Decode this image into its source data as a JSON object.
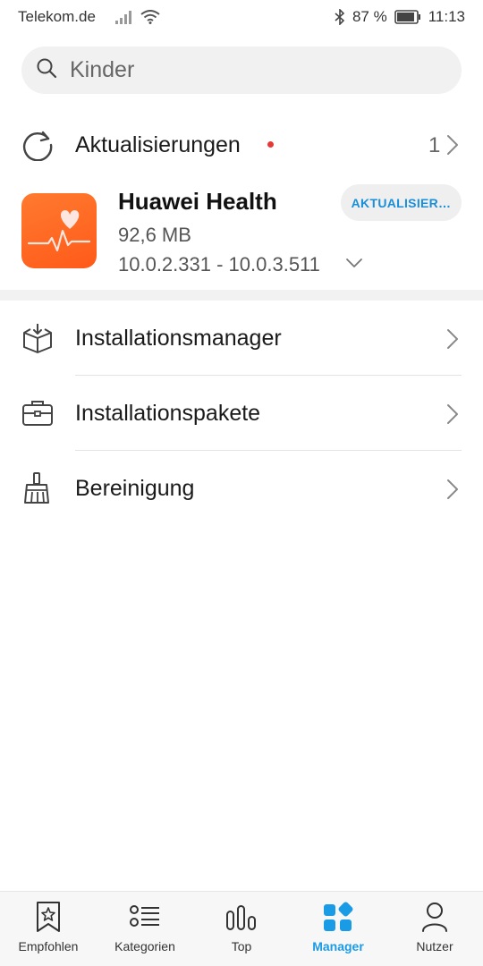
{
  "status_bar": {
    "carrier": "Telekom.de",
    "battery_percent": "87 %",
    "time": "11:13"
  },
  "search": {
    "placeholder": "Kinder"
  },
  "updates": {
    "title": "Aktualisierungen",
    "count": "1",
    "has_new_indicator": true
  },
  "app_update": {
    "name": "Huawei Health",
    "size": "92,6 MB",
    "version": "10.0.2.331 - 10.0.3.511",
    "button_label": "AKTUALISIER…",
    "icon": "heart-pulse-icon"
  },
  "menu": {
    "items": [
      {
        "label": "Installationsmanager",
        "icon": "install-box-icon"
      },
      {
        "label": "Installationspakete",
        "icon": "briefcase-icon"
      },
      {
        "label": "Bereinigung",
        "icon": "broom-icon"
      }
    ]
  },
  "bottom_nav": {
    "items": [
      {
        "label": "Empfohlen",
        "icon": "bookmark-star-icon"
      },
      {
        "label": "Kategorien",
        "icon": "list-icon"
      },
      {
        "label": "Top",
        "icon": "bar-chart-icon"
      },
      {
        "label": "Manager",
        "icon": "apps-grid-icon"
      },
      {
        "label": "Nutzer",
        "icon": "user-icon"
      }
    ],
    "active": "Manager"
  },
  "colors": {
    "accent": "#1a9be6",
    "app_icon": "#ff6420",
    "red_dot": "#e53935"
  }
}
